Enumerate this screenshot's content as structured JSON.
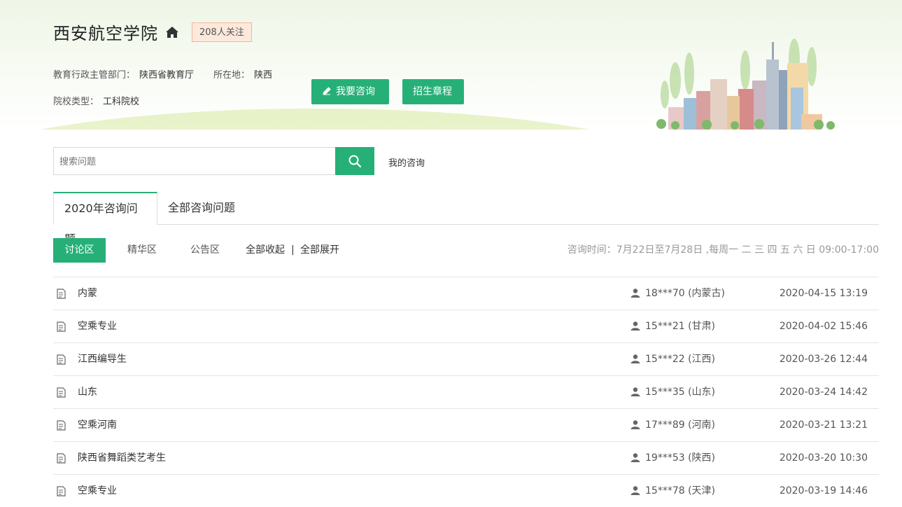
{
  "header": {
    "school_name": "西安航空学院",
    "follow_badge": "208人关注",
    "dept_label": "教育行政主管部门：",
    "dept_value": "陕西省教育厅",
    "location_label": "所在地：",
    "location_value": "陕西",
    "type_label": "院校类型：",
    "type_value": "工科院校",
    "consult_button": "我要咨询",
    "charter_button": "招生章程"
  },
  "search": {
    "placeholder": "搜索问题",
    "my_consult": "我的咨询"
  },
  "tabs": [
    {
      "label": "2020年咨询问题",
      "active": true
    },
    {
      "label": "全部咨询问题",
      "active": false
    }
  ],
  "subnav": {
    "areas": [
      "讨论区",
      "精华区",
      "公告区"
    ],
    "collapse_all": "全部收起",
    "separator": "|",
    "expand_all": "全部展开",
    "consult_time": "咨询时间：7月22日至7月28日 ,每周一 二 三 四 五 六 日 09:00-17:00"
  },
  "questions": [
    {
      "title": "内蒙",
      "user": "18***70 (内蒙古)",
      "date": "2020-04-15 13:19"
    },
    {
      "title": "空乘专业",
      "user": "15***21 (甘肃)",
      "date": "2020-04-02 15:46"
    },
    {
      "title": "江西编导生",
      "user": "15***22 (江西)",
      "date": "2020-03-26 12:44"
    },
    {
      "title": "山东",
      "user": "15***35 (山东)",
      "date": "2020-03-24 14:42"
    },
    {
      "title": "空乘河南",
      "user": "17***89 (河南)",
      "date": "2020-03-21 13:21"
    },
    {
      "title": "陕西省舞蹈类艺考生",
      "user": "19***53 (陕西)",
      "date": "2020-03-20 10:30"
    },
    {
      "title": "空乘专业",
      "user": "15***78 (天津)",
      "date": "2020-03-19 14:46"
    }
  ],
  "colors": {
    "accent": "#26b077",
    "badge_bg": "#fde9dc"
  },
  "icons": {
    "home": "home-icon",
    "edit": "pencil-icon",
    "search": "search-icon",
    "doc": "document-icon",
    "user": "user-icon"
  }
}
